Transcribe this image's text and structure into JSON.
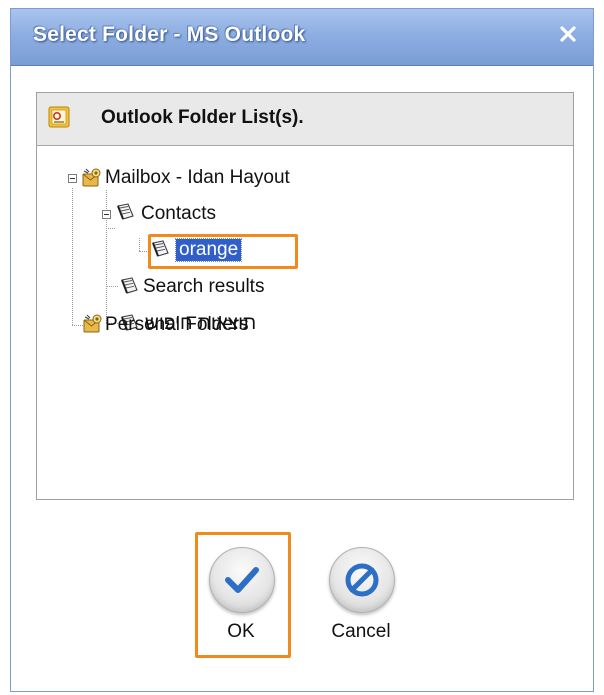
{
  "window": {
    "title": "Select Folder - MS Outlook",
    "close_icon": "close-icon"
  },
  "panel": {
    "title": "Outlook Folder List(s).",
    "icon": "outlook-folder-list-icon"
  },
  "tree": {
    "mailbox": {
      "label": "Mailbox - Idan Hayout",
      "icon": "mailbox-icon",
      "expanded": true
    },
    "contacts": {
      "label": "Contacts",
      "icon": "address-book-icon",
      "expanded": true
    },
    "orange": {
      "label": "orange",
      "icon": "address-book-icon",
      "selected": true
    },
    "search_results": {
      "label": "Search results",
      "icon": "address-book-icon"
    },
    "hebrew_results": {
      "label": "תוצאות חיפוש",
      "icon": "address-book-icon"
    },
    "personal_folders": {
      "label": "Personal Folders",
      "icon": "mailbox-icon"
    }
  },
  "buttons": {
    "ok_label": "OK",
    "cancel_label": "Cancel"
  },
  "colors": {
    "title_bar": "#8eaee2",
    "selection": "#2f5fc7",
    "highlight": "#f08a1c",
    "check": "#2d6fc4"
  }
}
